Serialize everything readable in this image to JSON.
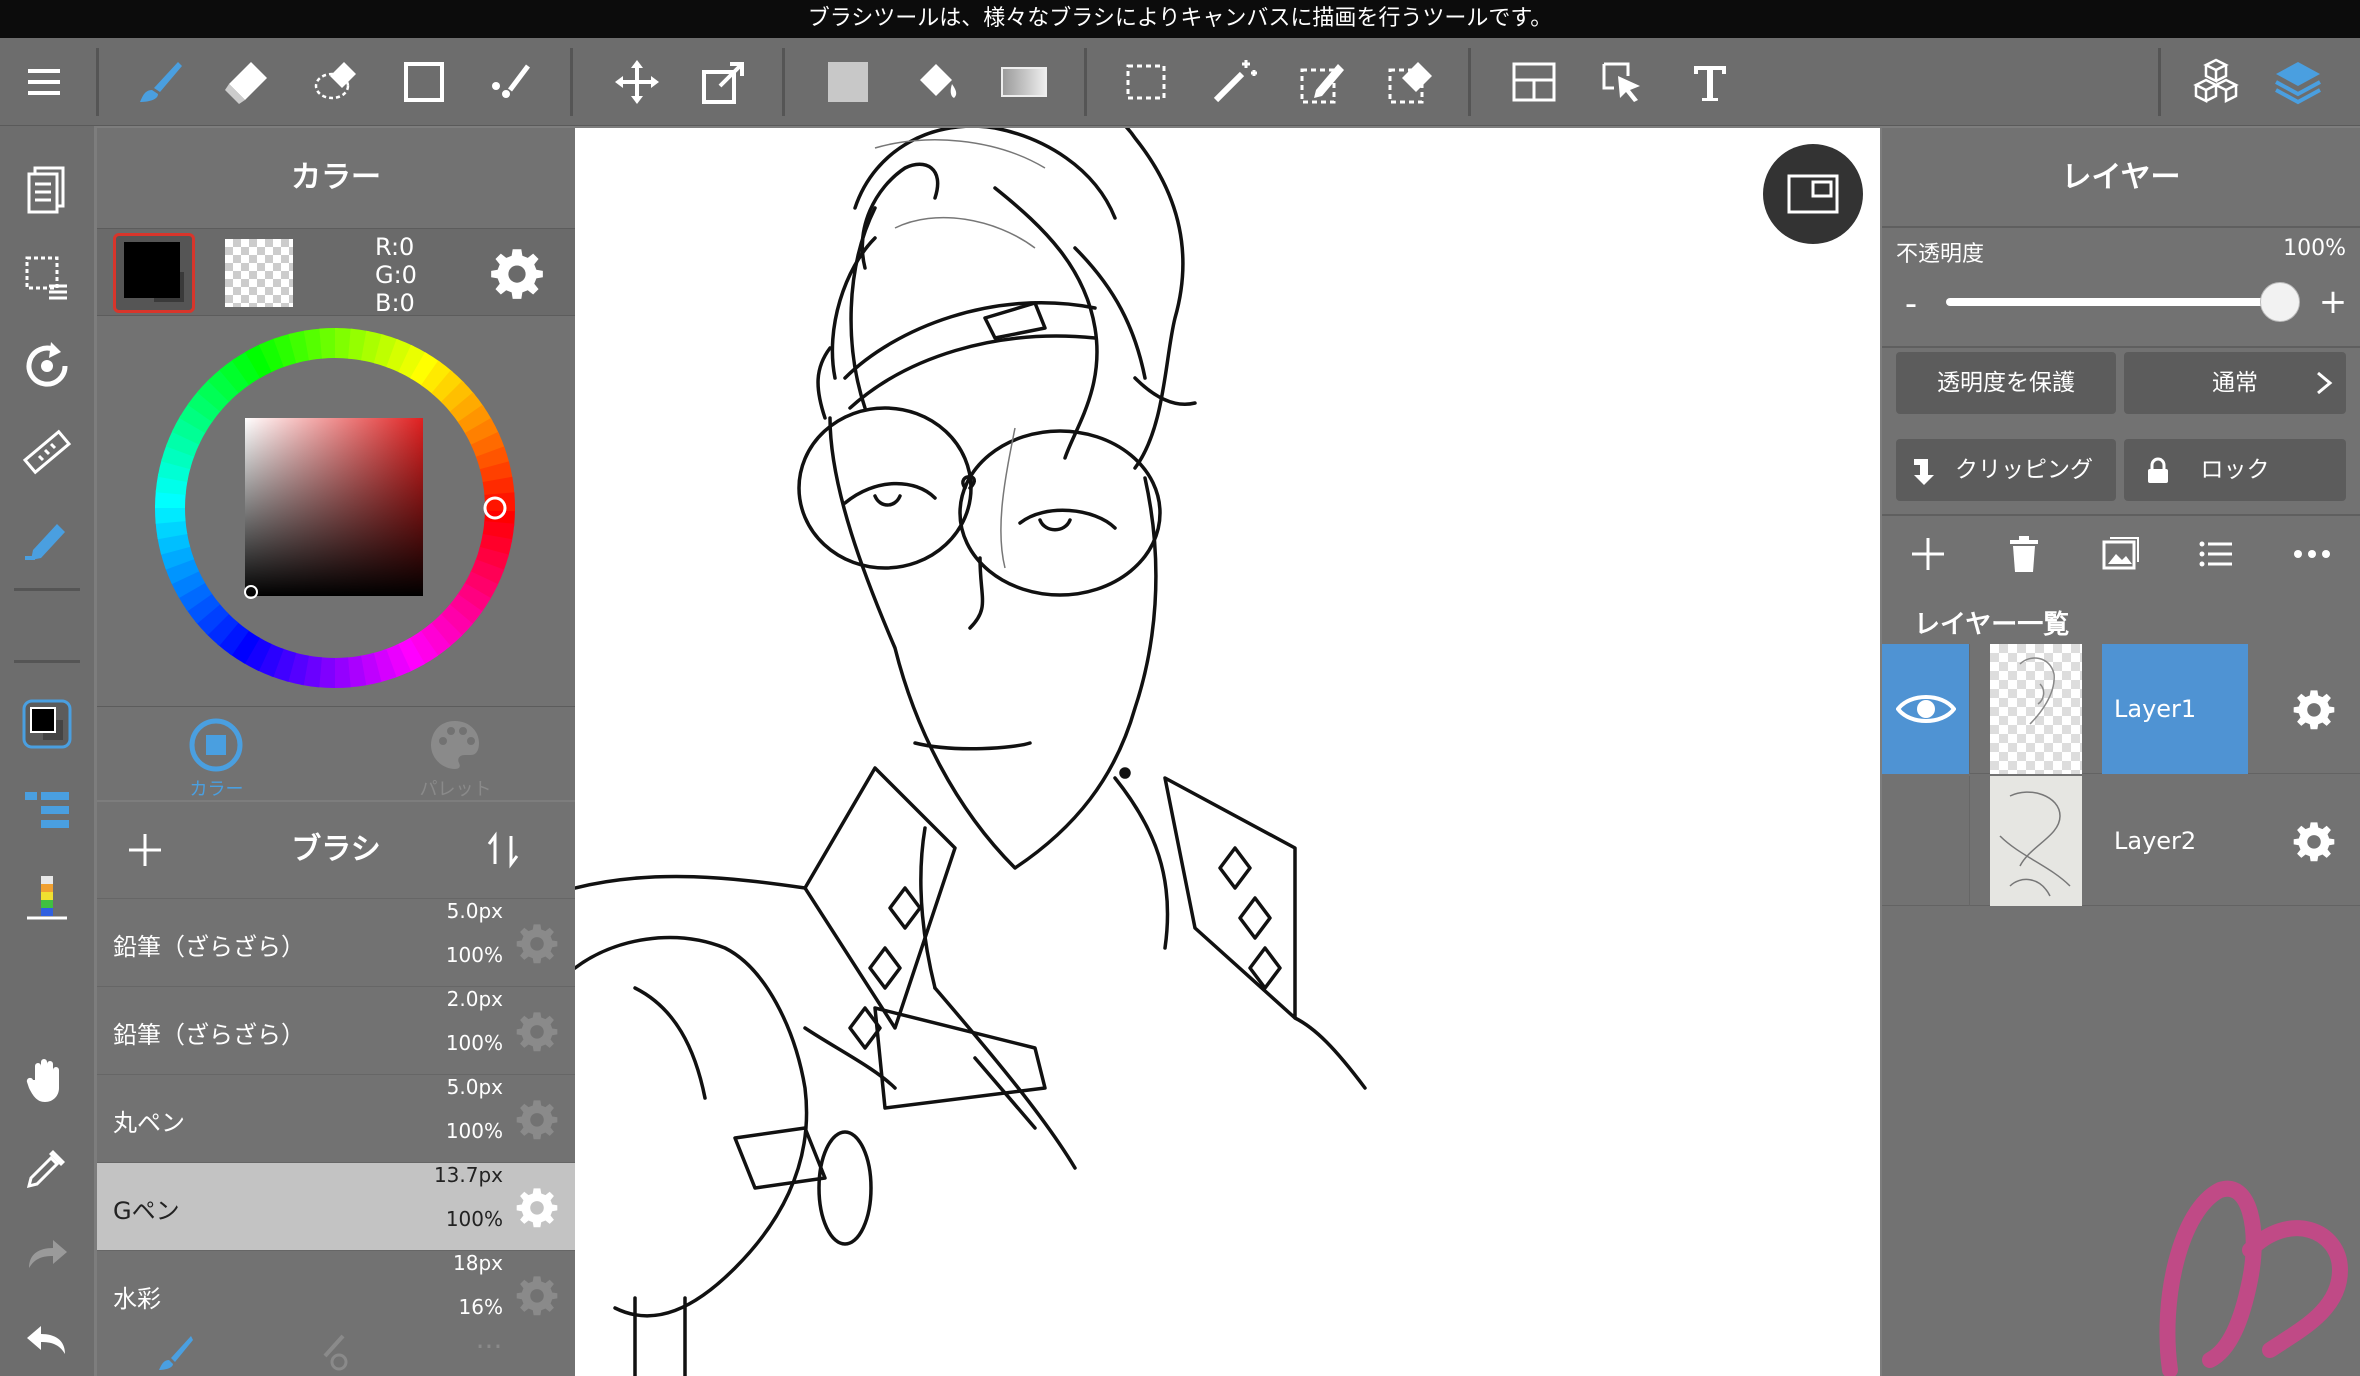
{
  "hint_bar": {
    "text": "ブラシツールは、様々なブラシによりキャンバスに描画を行うツールです。"
  },
  "top_toolbar": {
    "tools": [
      "menu-icon",
      "brush-icon",
      "eraser-icon",
      "lasso-eraser-icon",
      "shape-icon",
      "dot-icon",
      "move-icon",
      "transform-icon",
      "fill-rect-icon",
      "bucket-icon",
      "gradient-icon",
      "select-icon",
      "magic-wand-icon",
      "select-pen-icon",
      "select-eraser-icon",
      "panel-layout-icon",
      "operation-icon",
      "text-icon",
      "material-icon",
      "layers-icon"
    ],
    "accent": "#4a9fe0"
  },
  "left_toolbar": {
    "tools": [
      "pages-icon",
      "select-display-icon",
      "rotate-icon",
      "ruler-icon",
      "pen-snap-icon",
      "color-swatch-icon",
      "brush-list-icon",
      "color-bar-icon",
      "hand-icon",
      "eyedropper-icon",
      "redo-icon",
      "undo-icon"
    ]
  },
  "color_panel": {
    "title": "カラー",
    "rgb": {
      "r": "R:0",
      "g": "G:0",
      "b": "B:0"
    },
    "tabs": [
      {
        "label": "カラー",
        "active": true
      },
      {
        "label": "パレット",
        "active": false
      }
    ],
    "colors": {
      "foreground": "#000000",
      "selected_border": "#d8352b"
    }
  },
  "brush_panel": {
    "title": "ブラシ",
    "brushes": [
      {
        "name": "鉛筆（ざらざら）",
        "size": "5.0px",
        "opacity": "100%",
        "selected": false
      },
      {
        "name": "鉛筆（ざらざら）",
        "size": "2.0px",
        "opacity": "100%",
        "selected": false
      },
      {
        "name": "丸ペン",
        "size": "5.0px",
        "opacity": "100%",
        "selected": false
      },
      {
        "name": "Gペン",
        "size": "13.7px",
        "opacity": "100%",
        "selected": true
      },
      {
        "name": "水彩",
        "size": "18px",
        "opacity": "16%",
        "selected": false
      }
    ],
    "footer_more": "···"
  },
  "layer_panel": {
    "title": "レイヤー",
    "opacity_label": "不透明度",
    "opacity_value": "100%",
    "opacity_fraction": 1.0,
    "minus": "-",
    "plus": "+",
    "protect_alpha": "透明度を保護",
    "blend_mode": "通常",
    "clipping": "クリッピング",
    "lock": "ロック",
    "list_title": "レイヤー一覧",
    "layers": [
      {
        "name": "Layer1",
        "visible": true,
        "selected": true
      },
      {
        "name": "Layer2",
        "visible": false,
        "selected": false
      }
    ],
    "selected_color": "#4f93d3"
  }
}
